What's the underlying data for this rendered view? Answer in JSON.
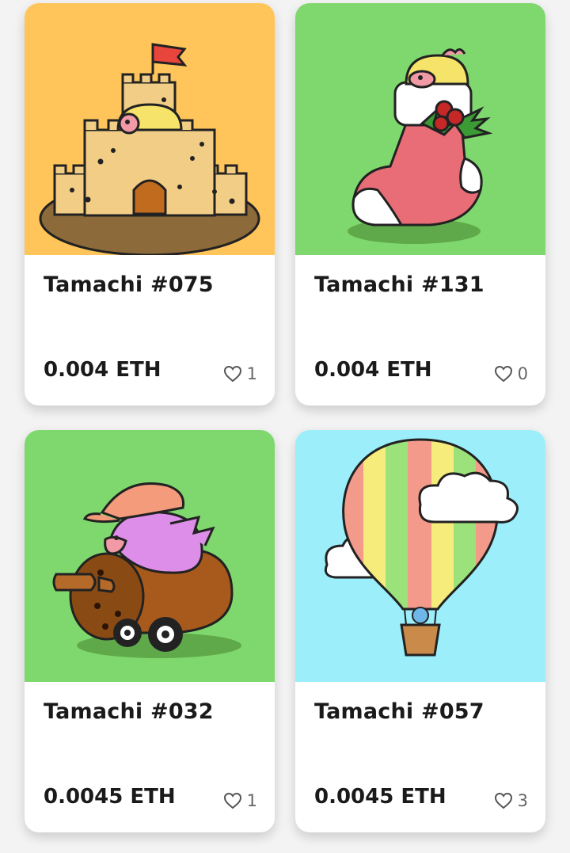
{
  "cards": [
    {
      "title": "Tamachi #075",
      "price": "0.004 ETH",
      "likes": "1",
      "bg": "#ffc55a",
      "art": "sandcastle"
    },
    {
      "title": "Tamachi #131",
      "price": "0.004 ETH",
      "likes": "0",
      "bg": "#7fd86e",
      "art": "christmas-stocking"
    },
    {
      "title": "Tamachi #032",
      "price": "0.0045 ETH",
      "likes": "1",
      "bg": "#7fd86e",
      "art": "cannon-car"
    },
    {
      "title": "Tamachi #057",
      "price": "0.0045 ETH",
      "likes": "3",
      "bg": "#9ceefa",
      "art": "hot-air-balloon"
    }
  ]
}
